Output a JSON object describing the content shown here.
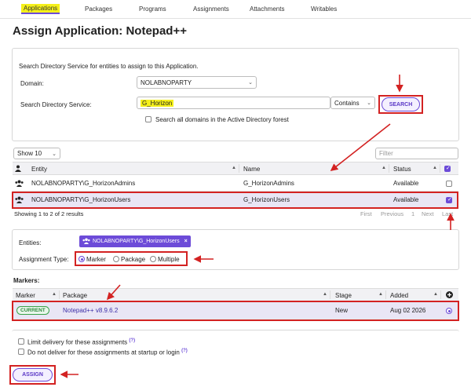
{
  "tabs": [
    {
      "label": "Applications"
    },
    {
      "label": "Packages"
    },
    {
      "label": "Programs"
    },
    {
      "label": "Assignments"
    },
    {
      "label": "Attachments"
    },
    {
      "label": "Writables"
    }
  ],
  "page_title": "Assign Application: Notepad++",
  "search_panel": {
    "intro": "Search Directory Service for entities to assign to this Application.",
    "domain_label": "Domain:",
    "domain_value": "NOLABNOPARTY",
    "search_label": "Search Directory Service:",
    "search_value": "G_Horizon",
    "match_mode": "Contains",
    "search_button": "SEARCH",
    "all_domains_label": "Search all domains in the Active Directory forest"
  },
  "results": {
    "page_size": "Show 10",
    "filter_placeholder": "Filter",
    "columns": [
      "Entity",
      "Name",
      "Status"
    ],
    "rows": [
      {
        "entity": "NOLABNOPARTY\\G_HorizonAdmins",
        "name": "G_HorizonAdmins",
        "status": "Available",
        "checked": false
      },
      {
        "entity": "NOLABNOPARTY\\G_HorizonUsers",
        "name": "G_HorizonUsers",
        "status": "Available",
        "checked": true
      }
    ],
    "summary": "Showing 1 to 2 of 2 results",
    "pager": [
      "First",
      "Previous",
      "1",
      "Next",
      "Last"
    ]
  },
  "assignment": {
    "entities_label": "Entities:",
    "entity_chip": "NOLABNOPARTY\\G_HorizonUsers",
    "type_label": "Assignment Type:",
    "types": [
      "Marker",
      "Package",
      "Multiple"
    ],
    "selected_type": "Marker"
  },
  "markers": {
    "heading": "Markers:",
    "columns": [
      "Marker",
      "Package",
      "Stage",
      "Added"
    ],
    "rows": [
      {
        "marker": "CURRENT",
        "package": "Notepad++ v8.9.6.2",
        "stage": "New",
        "added": "Aug 02 2026",
        "selected": true
      }
    ]
  },
  "options": {
    "limit_delivery": "Limit delivery for these assignments",
    "no_startup": "Do not deliver for these assignments at startup or login",
    "help_mark": "(?)"
  },
  "assign_button": "ASSIGN",
  "colors": {
    "accent": "#6c4bd8",
    "highlight": "#f5f01a",
    "callout": "#d32222",
    "current_badge": "#3aa34a"
  }
}
